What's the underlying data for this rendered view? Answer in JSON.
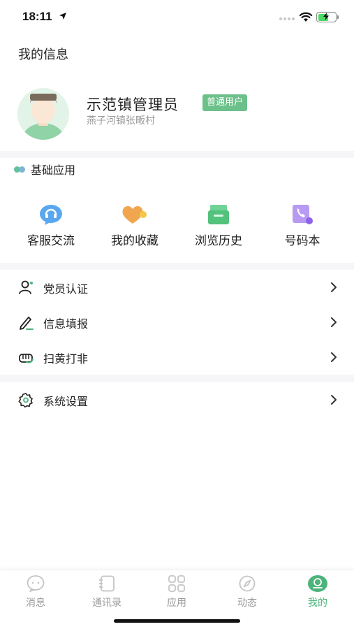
{
  "status_bar": {
    "time": "18:11"
  },
  "page": {
    "title": "我的信息"
  },
  "profile": {
    "name": "示范镇管理员",
    "badge": "普通用户",
    "village": "燕子河镇张畈村"
  },
  "basic_apps": {
    "title": "基础应用",
    "items": [
      {
        "label": "客服交流",
        "icon": "chat-icon",
        "color": "#5aa7f0"
      },
      {
        "label": "我的收藏",
        "icon": "heart-icon",
        "color": "#f0a64f"
      },
      {
        "label": "浏览历史",
        "icon": "history-icon",
        "color": "#52c27c"
      },
      {
        "label": "号码本",
        "icon": "phonebook-icon",
        "color": "#9b72ef"
      }
    ]
  },
  "menu": {
    "items": [
      {
        "label": "党员认证",
        "icon": "user-verify-icon"
      },
      {
        "label": "信息填报",
        "icon": "pencil-icon"
      },
      {
        "label": "扫黄打非",
        "icon": "fist-icon"
      },
      {
        "label": "系统设置",
        "icon": "gear-icon"
      }
    ]
  },
  "tabbar": {
    "items": [
      {
        "label": "消息",
        "icon": "message-icon"
      },
      {
        "label": "通讯录",
        "icon": "contacts-icon"
      },
      {
        "label": "应用",
        "icon": "apps-grid-icon"
      },
      {
        "label": "动态",
        "icon": "compass-icon"
      },
      {
        "label": "我的",
        "icon": "profile-icon",
        "active": true
      }
    ],
    "active_color": "#4cb37a",
    "inactive_color": "#999999"
  }
}
